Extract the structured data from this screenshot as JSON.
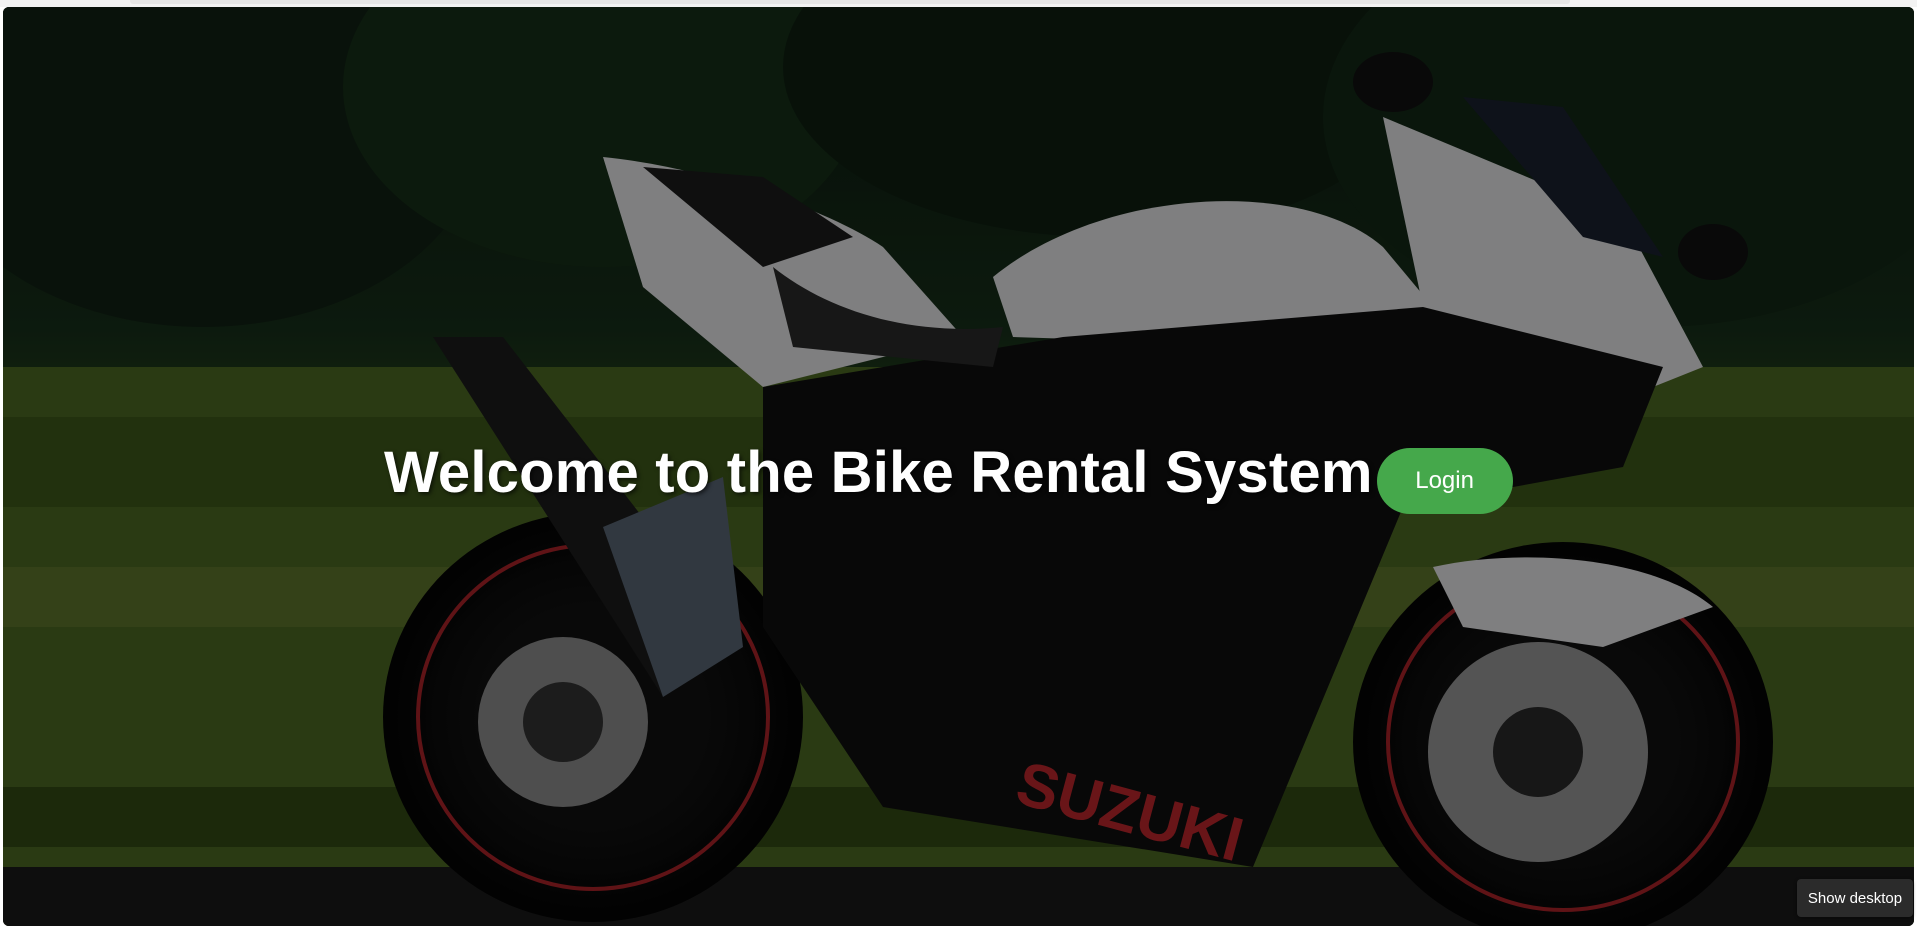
{
  "hero": {
    "title": "Welcome to the Bike Rental System",
    "login_label": "Login",
    "background_image": "motorcycle-photo",
    "brand_mark": "SUZUKI"
  },
  "taskbar": {
    "tooltip": "Show desktop"
  },
  "colors": {
    "accent": "#45a84b",
    "overlay": "rgba(0,0,0,0.45)",
    "title": "#ffffff"
  }
}
